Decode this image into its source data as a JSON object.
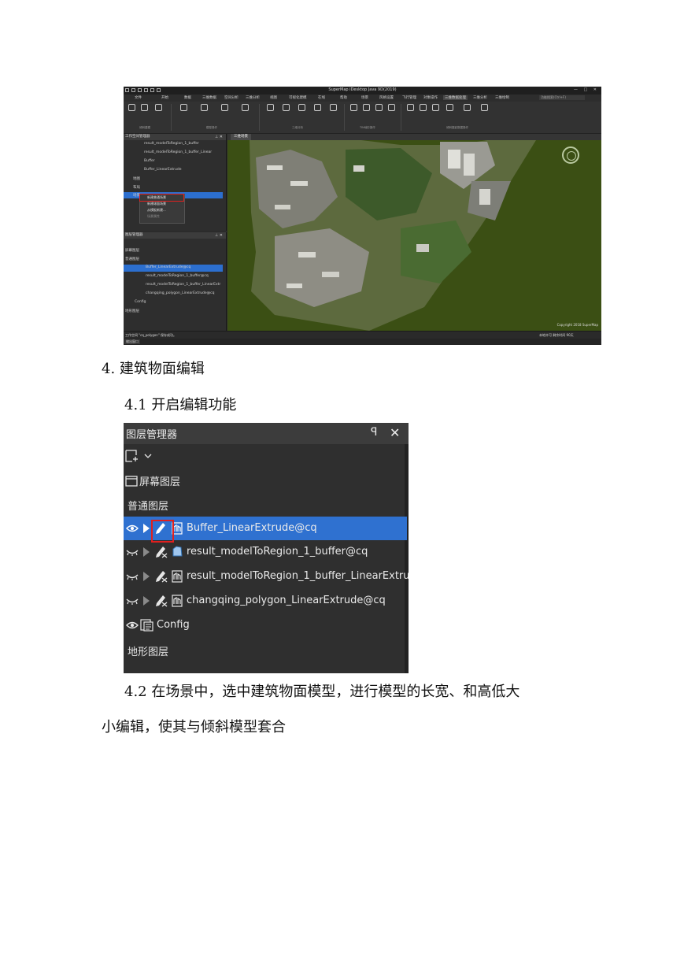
{
  "screenshot1": {
    "title": "SuperMap iDesktop Java 9D(2019)",
    "menu": [
      "文件",
      "开始",
      "数据",
      "三维数据",
      "空间分析",
      "三维分析",
      "视图",
      "可视化建模",
      "在线",
      "帮助",
      "场景",
      "风格设置",
      "飞行管理",
      "对象操作",
      "三维数据处理",
      "三维分析",
      "三维绘制"
    ],
    "search_placeholder": "功能搜索(Ctrl+F)",
    "ribbon_groups": [
      "倾斜建模",
      "模型操作",
      "三维分析",
      "TIN地形操作",
      "倾斜摄影数据操作"
    ],
    "workspace_panel_title": "工作空间管理器",
    "workspace_items": [
      "result_modelToRegion_1_buffer",
      "result_modelToRegion_1_buffer_Linear",
      "Buffer",
      "Buffer_LinearExtrude",
      "地图",
      "布局",
      "场景"
    ],
    "context_menu": [
      "新建普通场景",
      "新建球面场景",
      "从模板新建...",
      "场景属性"
    ],
    "layer_panel_title": "图层管理器",
    "layer_items": [
      "屏幕图层",
      "普通图层",
      "Buffer_LinearExtrude@cq",
      "result_modelToRegion_1_buffer@cq",
      "result_modelToRegion_1_buffer_LinearExtr",
      "changqing_polygon_LinearExtrude@cq",
      "Config",
      "地形图层"
    ],
    "scene_tab": "三维场景",
    "copyright": "Copyright 2018 SuperMap",
    "status_left": "工作空间 \"cq_polygon\" 保存成功。",
    "status_right": "本地许可 剩余时间 90天",
    "output_tab": "输出窗口"
  },
  "heading": "4. 建筑物面编辑",
  "sub_41": "4.1 开启编辑功能",
  "layer_manager": {
    "title": "图层管理器",
    "pin_icon": "pin-icon",
    "close_icon": "close-icon",
    "screen_layer": "屏幕图层",
    "normal_layers": "普通图层",
    "layers": [
      {
        "name": "Buffer_LinearExtrude@cq",
        "selected": true,
        "visible": true,
        "editable": true,
        "type": "model"
      },
      {
        "name": "result_modelToRegion_1_buffer@cq",
        "selected": false,
        "visible": false,
        "editable": false,
        "type": "region"
      },
      {
        "name": "result_modelToRegion_1_buffer_LinearExtru",
        "selected": false,
        "visible": false,
        "editable": false,
        "type": "model"
      },
      {
        "name": "changqing_polygon_LinearExtrude@cq",
        "selected": false,
        "visible": false,
        "editable": false,
        "type": "model"
      }
    ],
    "config": "Config",
    "terrain_layers": "地形图层"
  },
  "para_42_line1": "4.2 在场景中，选中建筑物面模型，进行模型的长宽、和高低大",
  "para_42_line2": "小编辑，使其与倾斜模型套合",
  "colors": {
    "selection": "#2f71d0",
    "highlight_box": "#e0201e",
    "panel_bg": "#2f2f2f"
  }
}
